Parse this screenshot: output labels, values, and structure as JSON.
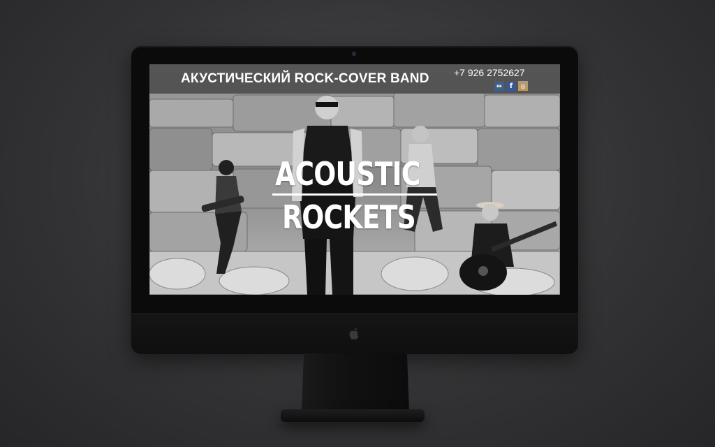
{
  "site": {
    "tagline": "АКУСТИЧЕСКИЙ ROCK-COVER BAND",
    "phone": "+7 926 2752627",
    "social": [
      {
        "label": "вк",
        "icon": "vk-icon",
        "color": "#3f5f86"
      },
      {
        "label": "f",
        "icon": "facebook-icon",
        "color": "#3b5790"
      },
      {
        "label": "◎",
        "icon": "instagram-icon",
        "color": "#b89a6a"
      }
    ],
    "logo": {
      "line1": "ACOUSTIC",
      "line2": "ROCKETS"
    }
  }
}
